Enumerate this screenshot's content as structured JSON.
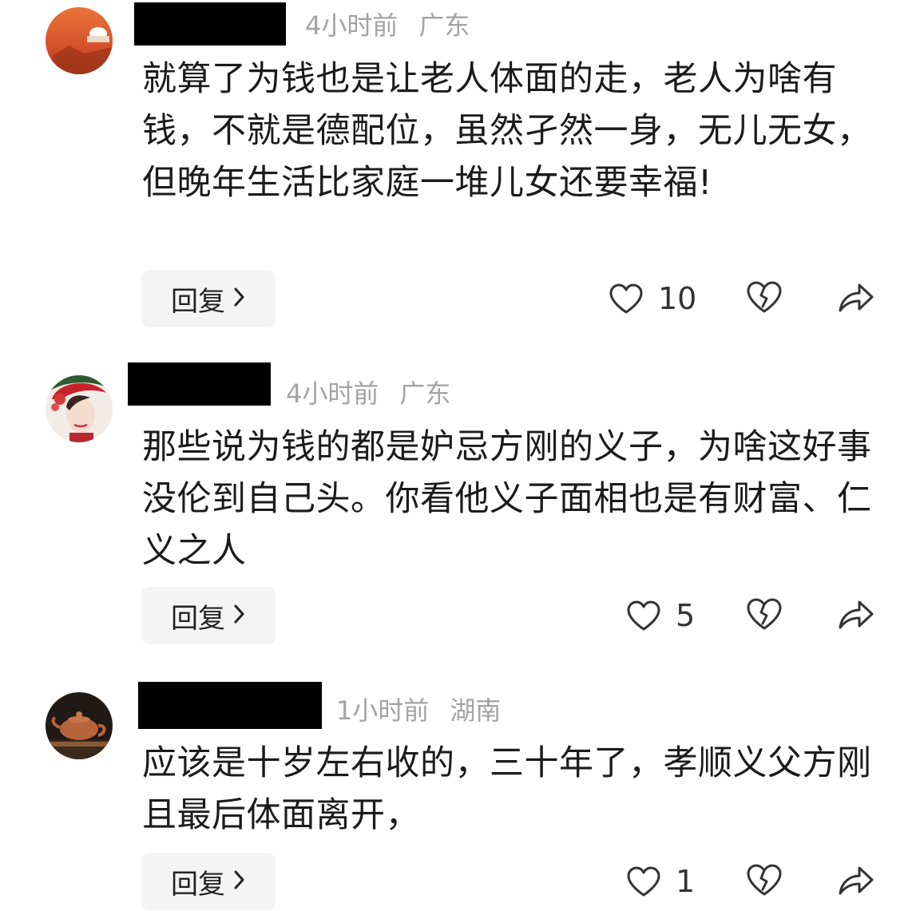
{
  "comments": [
    {
      "time": "4小时前",
      "location": "广东",
      "text": "就算了为钱也是让老人体面的走，老人为啥有钱，不就是德配位，虽然孑然一身，无儿无女，但晚年生活比家庭一堆儿女还要幸福!",
      "reply_label": "回复",
      "likes": "10",
      "avatar_icon": "orange-sunset-avatar"
    },
    {
      "time": "4小时前",
      "location": "广东",
      "text": "那些说为钱的都是妒忌方刚的义子，为啥这好事没伦到自己头。你看他义子面相也是有财富、仁义之人",
      "reply_label": "回复",
      "likes": "5",
      "avatar_icon": "woman-portrait-avatar"
    },
    {
      "time": "1小时前",
      "location": "湖南",
      "text": "应该是十岁左右收的，三十年了，孝顺义父方刚且最后体面离开，",
      "reply_label": "回复",
      "likes": "1",
      "avatar_icon": "teapot-avatar"
    }
  ],
  "colors": {
    "meta": "#a3a3a3",
    "reply_bg": "#f4f4f4",
    "icon": "#333333",
    "redaction": "#000000"
  }
}
